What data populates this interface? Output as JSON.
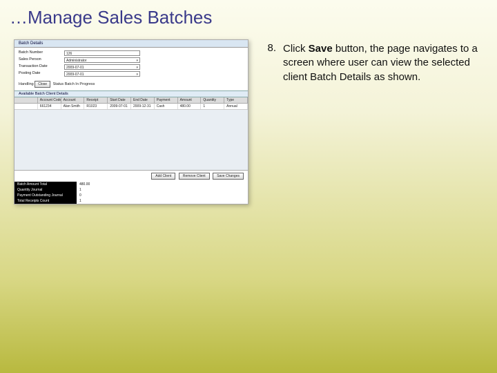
{
  "title": "…Manage Sales Batches",
  "step": {
    "number": "8.",
    "prefix": "Click ",
    "bold": "Save",
    "suffix": " button, the page navigates to a screen where user can view the selected client Batch Details as shown."
  },
  "screenshot": {
    "topbar": "Batch Details",
    "form": {
      "labels": {
        "batch_number": "Batch Number",
        "sales_person": "Sales Person",
        "transaction_date": "Transaction Date",
        "posting_date": "Posting Date"
      },
      "values": {
        "batch_number": "126",
        "sales_person": "Administrator",
        "transaction_date": "2009-07-01",
        "posting_date": "2009-07-01"
      }
    },
    "handling": {
      "label": "Handling",
      "close_btn": "Close",
      "batch_label": "Status Batch",
      "batch_value": "In Progress"
    },
    "section_head": "Available Batch Client Details",
    "columns": [
      "",
      "Account Code",
      "Account",
      "Receipt",
      "Start Date",
      "End Date",
      "Payment",
      "Amount",
      "Quantity",
      "Type"
    ],
    "row": [
      "",
      "661234",
      "Alan Smith",
      "R1023",
      "2009-07-01",
      "2009-12-31",
      "Cash",
      "480.00",
      "1",
      "Annual"
    ],
    "buttons": {
      "add": "Add Client",
      "remove": "Remove Client",
      "save": "Save Changes"
    },
    "summary": [
      {
        "label": "Batch Amount Total",
        "value": "480.00"
      },
      {
        "label": "Quantity Journal",
        "value": "1"
      },
      {
        "label": "Payment Outstanding Journal",
        "value": "0"
      },
      {
        "label": "Total Receipts Count",
        "value": "1"
      }
    ]
  }
}
